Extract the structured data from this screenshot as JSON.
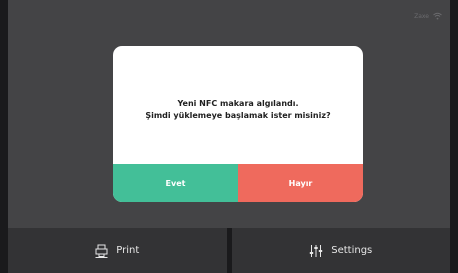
{
  "status_bar": {
    "device_name": "Zaxe",
    "wifi_icon": "wifi-icon"
  },
  "dialog": {
    "message_line1": "Yeni NFC makara algılandı.",
    "message_line2": "Şimdi yüklemeye başlamak ister misiniz?",
    "confirm_label": "Evet",
    "cancel_label": "Hayır"
  },
  "nav": {
    "print_label": "Print",
    "print_icon": "printer-icon",
    "settings_label": "Settings",
    "settings_icon": "sliders-icon"
  },
  "colors": {
    "confirm": "#43bf98",
    "cancel": "#ef6a5d",
    "screen_bg": "#444446",
    "nav_bg": "#333335"
  }
}
